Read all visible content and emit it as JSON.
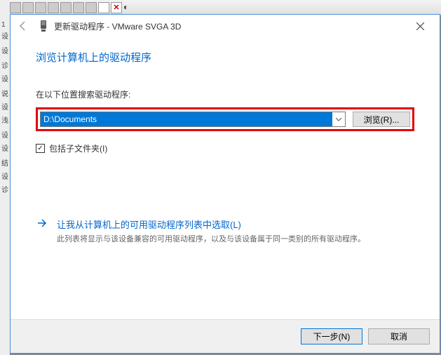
{
  "titlebar": {
    "title": "更新驱动程序 - VMware SVGA 3D"
  },
  "content": {
    "heading": "浏览计算机上的驱动程序",
    "search_label": "在以下位置搜索驱动程序:",
    "path_value": "D:\\Documents",
    "browse_label": "浏览(R)...",
    "include_sub_label": "包括子文件夹(I)",
    "include_sub_checked": "✓"
  },
  "option": {
    "title": "让我从计算机上的可用驱动程序列表中选取(L)",
    "desc": "此列表将显示与该设备兼容的可用驱动程序，以及与该设备属于同一类别的所有驱动程序。"
  },
  "footer": {
    "next": "下一步(N)",
    "cancel": "取消"
  }
}
